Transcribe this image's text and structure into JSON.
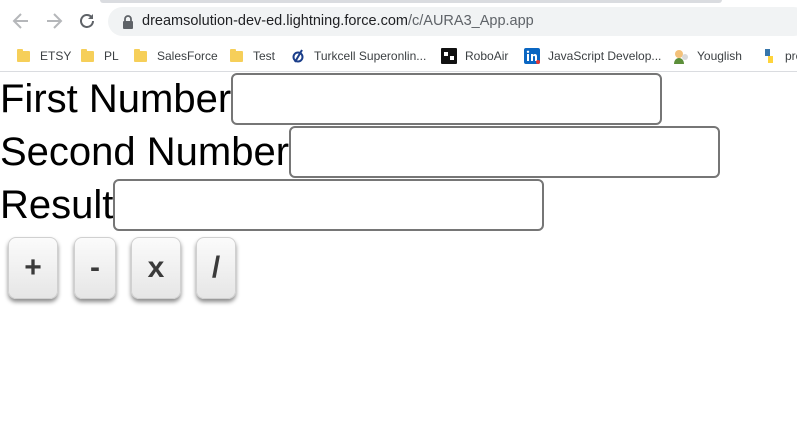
{
  "browser": {
    "url_host": "dreamsolution-dev-ed.lightning.force.com",
    "url_path": "/c/AURA3_App.app",
    "bookmarks": [
      {
        "label": "ETSY",
        "icon": "folder-icon"
      },
      {
        "label": "PL",
        "icon": "folder-icon"
      },
      {
        "label": "SalesForce",
        "icon": "folder-icon"
      },
      {
        "label": "Test",
        "icon": "folder-icon"
      },
      {
        "label": "Turkcell Superonlin...",
        "icon": "turkcell-icon"
      },
      {
        "label": "RoboAir",
        "icon": "roboair-icon"
      },
      {
        "label": "JavaScript Develop...",
        "icon": "linkedin-icon"
      },
      {
        "label": "Youglish",
        "icon": "youglish-icon"
      },
      {
        "label": "pre",
        "icon": "python-icon"
      }
    ]
  },
  "form": {
    "first_label": "First Number",
    "first_value": "",
    "second_label": "Second Number",
    "second_value": "",
    "result_label": "Result",
    "result_value": ""
  },
  "operations": {
    "add": "+",
    "subtract": "-",
    "multiply": "x",
    "divide": "/"
  },
  "colors": {
    "folder": "#f6cf59",
    "input_border": "#767676",
    "omnibox_bg": "#f1f3f4"
  }
}
